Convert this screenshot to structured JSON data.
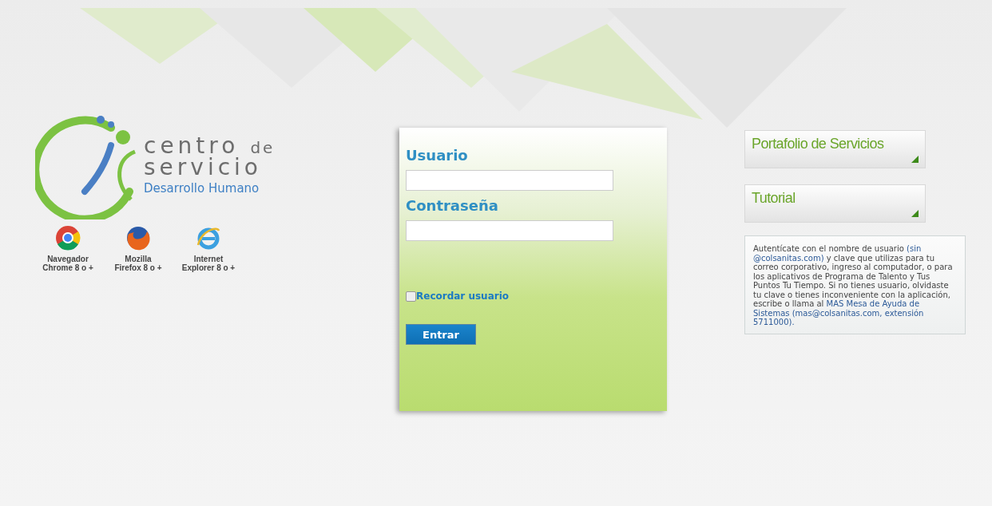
{
  "logo": {
    "line_1": "centro",
    "line_1_suffix": "de",
    "line_2": "servicio",
    "line_3": "Desarrollo Humano"
  },
  "browsers": [
    {
      "kind": "chrome",
      "line_1": "Navegador",
      "line_2": "Chrome 8 o +"
    },
    {
      "kind": "firefox",
      "line_1": "Mozilla",
      "line_2": "Firefox 8 o +"
    },
    {
      "kind": "ie",
      "line_1": "Internet",
      "line_2": "Explorer 8 o +"
    }
  ],
  "login": {
    "username_label": "Usuario",
    "password_label": "Contraseña",
    "remember": {
      "label": "Recordar usuario",
      "checked": false
    },
    "submit": "Entrar"
  },
  "links": [
    {
      "label": "Portafolio de Servicios"
    },
    {
      "label": "Tutorial"
    }
  ],
  "help_text": [
    {
      "text": "Autentícate con el nombre de usuario ",
      "highlight": false
    },
    {
      "text": "(sin @colsanitas.com)",
      "highlight": true
    },
    {
      "text": " y clave que utilizas para tu correo corporativo, ingreso al computador, o para los aplicativos de Programa de Talento y Tus Puntos Tu Tiempo. Si no tienes usuario, olvidaste tu clave o tienes inconveniente  con la aplicación, escribe o llama al ",
      "highlight": false
    },
    {
      "text": "MAS Mesa de Ayuda de Sistemas (mas@colsanitas.com, extensión 5711000).",
      "highlight": true
    }
  ]
}
